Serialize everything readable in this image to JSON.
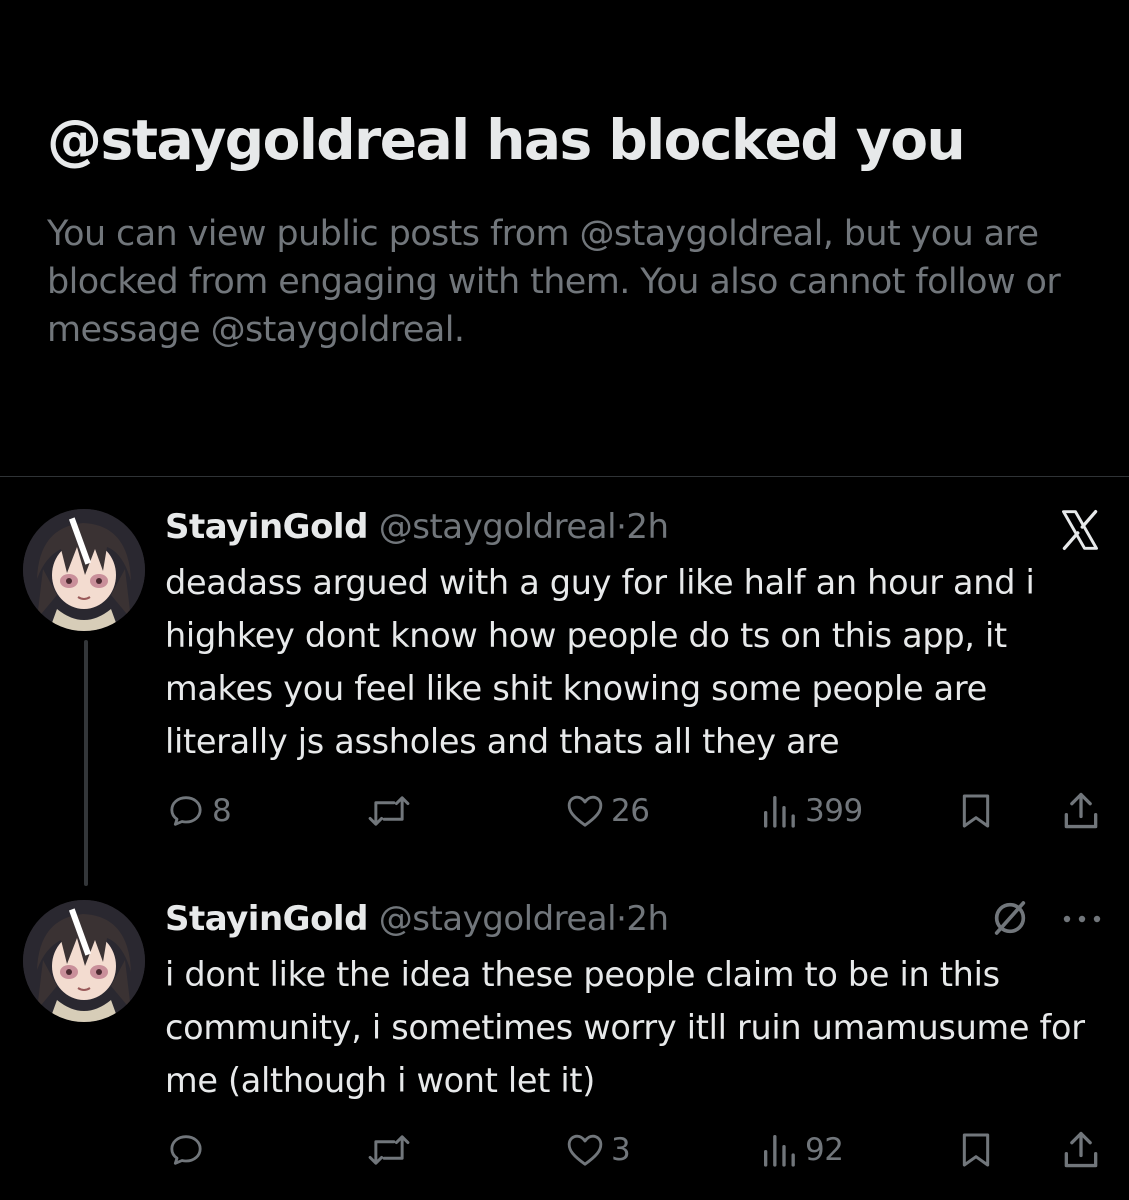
{
  "block_notice": {
    "title": "@staygoldreal has blocked you",
    "description": "You can view public posts from @staygoldreal, but you are blocked from engaging with them. You also cannot follow or message @staygoldreal."
  },
  "posts": [
    {
      "display_name": "StayinGold",
      "handle": "@staygoldreal",
      "separator": "·",
      "time": "2h",
      "text": "deadass argued with a guy for like half an hour and i highkey dont know how people do ts on this app, it makes you feel like shit knowing some people are literally js assholes and thats all they are",
      "header_icon": "x-logo-icon",
      "replies": "8",
      "reposts": "",
      "likes": "26",
      "views": "399"
    },
    {
      "display_name": "StayinGold",
      "handle": "@staygoldreal",
      "separator": "·",
      "time": "2h",
      "text": "i dont like the idea these people claim to be in this community, i sometimes worry itll ruin umamusume for me (although i wont let it)",
      "header_icon": "no-reply-icon",
      "replies": "",
      "reposts": "",
      "likes": "3",
      "views": "92"
    }
  ],
  "colors": {
    "background": "#000000",
    "primary_text": "#e7e9ea",
    "secondary_text": "#71767b",
    "divider": "#2f3336"
  }
}
